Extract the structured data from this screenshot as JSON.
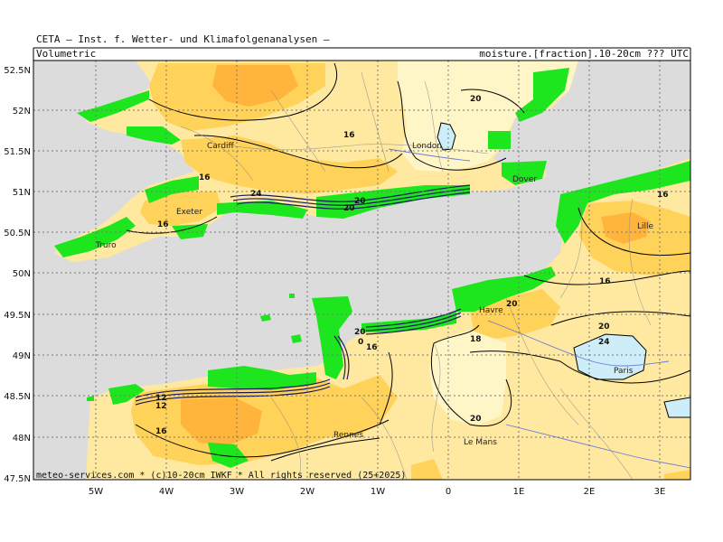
{
  "header": {
    "title": "CETA — Inst. f. Wetter- und Klimafolgenanalysen —",
    "left": "Volumetric",
    "right": "moisture.[fraction].10-20cm ??? UTC"
  },
  "axes": {
    "lat_labels": [
      "52.5N",
      "52N",
      "51.5N",
      "51N",
      "50.5N",
      "50N",
      "49.5N",
      "49N",
      "48.5N",
      "48N",
      "47.5N"
    ],
    "lon_labels": [
      "5W",
      "4W",
      "3W",
      "2W",
      "1W",
      "0",
      "1E",
      "2E",
      "3E"
    ]
  },
  "cities": [
    "Cardiff",
    "London",
    "Dover",
    "Exeter",
    "Truro",
    "Lille",
    "Paris",
    "Le Mans",
    "Rennes",
    "Havre"
  ],
  "contour_labels": [
    "16",
    "16",
    "20",
    "24",
    "16",
    "20",
    "16",
    "20",
    "24",
    "20",
    "18",
    "16",
    "20",
    "20",
    "16",
    "0",
    "12",
    "12",
    "20",
    "16"
  ],
  "footer": {
    "credit": "meteo-services.com * (c)10-20cm IWKF * All rights reserved (25+2025)"
  },
  "colors": {
    "sea": "#dcdcdc",
    "land_green": "#1ee61e",
    "pale_yellow": "#fff6c8",
    "yellow": "#ffe9a0",
    "gold": "#ffd25a",
    "orange": "#ffb43c",
    "light_blue": "#cdeef8",
    "frame": "#000000"
  }
}
